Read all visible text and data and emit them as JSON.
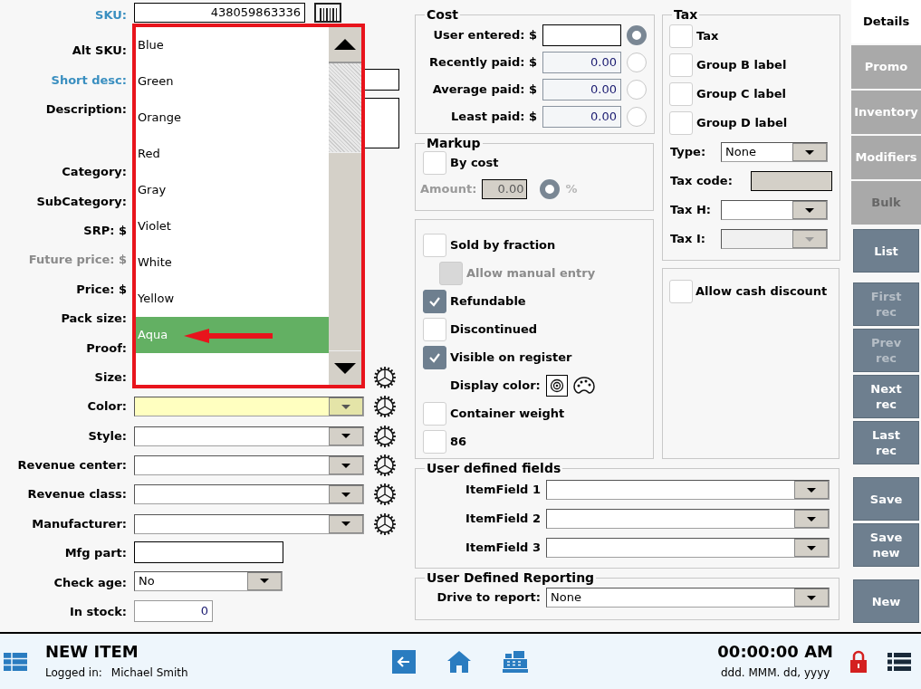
{
  "form": {
    "rows": [
      {
        "label": "SKU:",
        "kind": "link",
        "disabled": false,
        "gear": false,
        "field": {
          "kind": "code",
          "value": "438059863336",
          "focused": false
        }
      },
      {
        "label": "Alt SKU:",
        "kind": "plain",
        "disabled": false,
        "gear": false
      },
      {
        "label": "Short desc:",
        "kind": "link",
        "disabled": false,
        "gear": false,
        "field": {
          "kind": "text",
          "focused": false
        }
      },
      {
        "label": "Description:",
        "kind": "plain",
        "disabled": false,
        "gear": false,
        "field": {
          "kind": "memo",
          "focused": false
        }
      },
      {
        "label": "Category:",
        "kind": "plain",
        "disabled": false,
        "gear": false
      },
      {
        "label": "SubCategory:",
        "kind": "plain",
        "disabled": false,
        "gear": false
      },
      {
        "label": "SRP: $",
        "kind": "plain",
        "disabled": false,
        "gear": false
      },
      {
        "label": "Future price: $",
        "kind": "plain",
        "disabled": true,
        "gear": false
      },
      {
        "label": "Price: $",
        "kind": "plain",
        "disabled": false,
        "gear": false
      },
      {
        "label": "Pack size:",
        "kind": "plain",
        "disabled": false,
        "gear": false
      },
      {
        "label": "Proof:",
        "kind": "plain",
        "disabled": false,
        "gear": false
      },
      {
        "label": "Size:",
        "kind": "plain",
        "disabled": false,
        "gear": true
      },
      {
        "label": "Color:",
        "kind": "plain",
        "disabled": false,
        "gear": true,
        "field": {
          "kind": "combo",
          "focused": true
        }
      },
      {
        "label": "Style:",
        "kind": "plain",
        "disabled": false,
        "gear": true,
        "field": {
          "kind": "combo",
          "focused": false
        }
      },
      {
        "label": "Revenue center:",
        "kind": "plain",
        "disabled": false,
        "gear": true,
        "field": {
          "kind": "combo",
          "focused": false
        }
      },
      {
        "label": "Revenue class:",
        "kind": "plain",
        "disabled": false,
        "gear": true,
        "field": {
          "kind": "combo",
          "focused": false
        }
      },
      {
        "label": "Manufacturer:",
        "kind": "plain",
        "disabled": false,
        "gear": true,
        "field": {
          "kind": "combo",
          "focused": false
        }
      },
      {
        "label": "Mfg part:",
        "kind": "plain",
        "disabled": false,
        "gear": false,
        "field": {
          "kind": "part",
          "focused": false
        }
      },
      {
        "label": "Check age:",
        "kind": "plain",
        "disabled": false,
        "gear": false,
        "field": {
          "kind": "small_combo",
          "value": "No",
          "focused": false
        }
      },
      {
        "label": "In stock:",
        "kind": "plain",
        "disabled": false,
        "gear": false,
        "field": {
          "kind": "number",
          "value": "0",
          "focused": false
        }
      }
    ]
  },
  "dropdown": {
    "items": [
      {
        "label": "Blue",
        "selected": false
      },
      {
        "label": "Green",
        "selected": false
      },
      {
        "label": "Orange",
        "selected": false
      },
      {
        "label": "Red",
        "selected": false
      },
      {
        "label": "Gray",
        "selected": false
      },
      {
        "label": "Violet",
        "selected": false
      },
      {
        "label": "White",
        "selected": false
      },
      {
        "label": "Yellow",
        "selected": false
      },
      {
        "label": "Aqua",
        "selected": true
      }
    ]
  },
  "cost": {
    "title": "Cost",
    "rows": [
      {
        "label": "User entered: $",
        "editable": true,
        "selected": true
      },
      {
        "label": "Recently paid: $",
        "value": "0.00",
        "editable": false,
        "selected": false
      },
      {
        "label": "Average paid: $",
        "value": "0.00",
        "editable": false,
        "selected": false
      },
      {
        "label": "Least paid: $",
        "value": "0.00",
        "editable": false,
        "selected": false
      }
    ]
  },
  "markup": {
    "title": "Markup",
    "by_cost": {
      "label": "By cost",
      "checked": false
    },
    "amount": {
      "label": "Amount:",
      "value": "0.00",
      "disabled": true
    },
    "percent": {
      "label": "%",
      "selected": true,
      "disabled": true
    }
  },
  "options": [
    {
      "kind": "checkbox",
      "label": "Sold by fraction",
      "checked": false,
      "disabled": false
    },
    {
      "kind": "checkbox",
      "label": "Allow manual entry",
      "checked": false,
      "disabled": true
    },
    {
      "kind": "checkbox",
      "label": "Refundable",
      "checked": true,
      "disabled": false
    },
    {
      "kind": "checkbox",
      "label": "Discontinued",
      "checked": false,
      "disabled": false
    },
    {
      "kind": "checkbox",
      "label": "Visible on register",
      "checked": true,
      "disabled": false
    },
    {
      "kind": "color",
      "label": "Display color:"
    },
    {
      "kind": "checkbox",
      "label": "Container weight",
      "checked": false,
      "disabled": false
    },
    {
      "kind": "checkbox",
      "label": "86",
      "checked": false,
      "disabled": false
    }
  ],
  "user_defined_fields": {
    "title": "User defined fields",
    "fields": [
      {
        "label": "ItemField 1"
      },
      {
        "label": "ItemField 2"
      },
      {
        "label": "ItemField 3"
      }
    ]
  },
  "user_defined_reporting": {
    "title": "User Defined Reporting",
    "label": "Drive to report:",
    "value": "None"
  },
  "tax": {
    "title": "Tax",
    "checks": [
      {
        "label": "Tax",
        "checked": false
      },
      {
        "label": "Group B label",
        "checked": false
      },
      {
        "label": "Group C label",
        "checked": false
      },
      {
        "label": "Group D label",
        "checked": false
      }
    ],
    "fields": [
      {
        "kind": "combo",
        "label": "Type:",
        "value": "None",
        "disabled": false
      },
      {
        "kind": "readonly",
        "label": "Tax code:",
        "disabled": true
      },
      {
        "kind": "combo",
        "label": "Tax H:",
        "disabled": false
      },
      {
        "kind": "combo",
        "label": "Tax I:",
        "disabled": true
      }
    ]
  },
  "discount": {
    "label": "Allow cash discount",
    "checked": false
  },
  "sidebar": {
    "tabs": [
      {
        "label": "Details",
        "selected": true,
        "disabled": false
      },
      {
        "label": "Promo",
        "selected": false,
        "disabled": false
      },
      {
        "label": "Inventory",
        "selected": false,
        "disabled": false
      },
      {
        "label": "Modifiers",
        "selected": false,
        "disabled": false
      },
      {
        "label": "Bulk",
        "selected": false,
        "disabled": true
      }
    ],
    "buttons": [
      {
        "label": "List",
        "disabled": false
      },
      {
        "label": "First\nrec",
        "disabled": true
      },
      {
        "label": "Prev\nrec",
        "disabled": true
      },
      {
        "label": "Next\nrec",
        "disabled": false
      },
      {
        "label": "Last\nrec",
        "disabled": false
      },
      {
        "label": "Save",
        "disabled": false
      },
      {
        "label": "Save\nnew",
        "disabled": false
      },
      {
        "label": "New",
        "disabled": false
      }
    ]
  },
  "status_bar": {
    "title": "NEW ITEM",
    "logged_in_label": "Logged in:",
    "user": "Michael Smith",
    "time": "00:00:00 AM",
    "date": "ddd. MMM. dd, yyyy"
  }
}
